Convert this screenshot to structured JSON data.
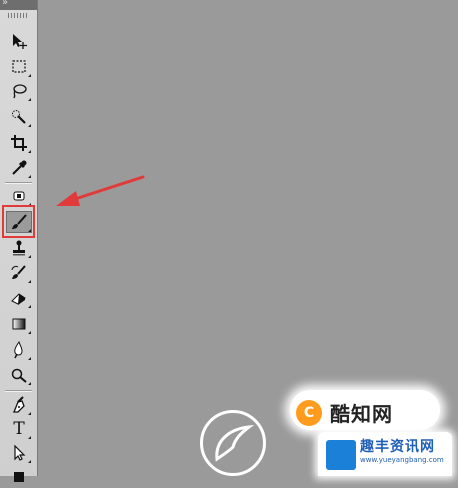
{
  "toolbar": {
    "collapse_label": "»",
    "tools": [
      {
        "name": "move-tool",
        "icon": "move-icon"
      },
      {
        "name": "marquee-tool",
        "icon": "marquee-icon"
      },
      {
        "name": "lasso-tool",
        "icon": "lasso-icon"
      },
      {
        "name": "quick-selection-tool",
        "icon": "quick-selection-icon"
      },
      {
        "name": "crop-tool",
        "icon": "crop-icon"
      },
      {
        "name": "eyedropper-tool",
        "icon": "eyedropper-icon"
      },
      {
        "name": "healing-brush-tool",
        "icon": "bandage-icon"
      },
      {
        "name": "brush-tool",
        "icon": "brush-icon",
        "selected": true
      },
      {
        "name": "clone-stamp-tool",
        "icon": "stamp-icon"
      },
      {
        "name": "history-brush-tool",
        "icon": "history-brush-icon"
      },
      {
        "name": "eraser-tool",
        "icon": "eraser-icon"
      },
      {
        "name": "gradient-tool",
        "icon": "gradient-icon"
      },
      {
        "name": "blur-tool",
        "icon": "blur-icon"
      },
      {
        "name": "dodge-tool",
        "icon": "dodge-icon"
      },
      {
        "name": "pen-tool",
        "icon": "pen-icon"
      },
      {
        "name": "type-tool",
        "icon": "type-icon",
        "glyph": "T"
      },
      {
        "name": "path-selection-tool",
        "icon": "path-selection-icon"
      },
      {
        "name": "rectangle-tool",
        "icon": "rectangle-icon"
      }
    ]
  },
  "annotation": {
    "color": "#e03a3a"
  },
  "watermark": {
    "brand_logo_glyph": "C",
    "brand_name": "酷知网",
    "site_name": "趣丰资讯网",
    "site_url": "www.yueyangbang.com"
  },
  "colors": {
    "canvas": "#9a9a9a",
    "toolbar": "#d4d4d4",
    "highlight": "#e03a3a"
  }
}
